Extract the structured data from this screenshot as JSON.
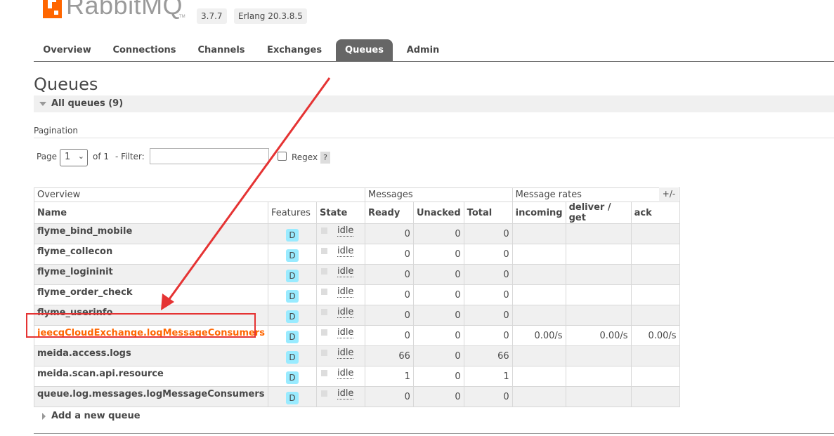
{
  "header": {
    "logo_text": "RabbitMQ",
    "logo_tm": "TM",
    "rabbitmq_version": "3.7.7",
    "erlang_version": "Erlang 20.3.8.5"
  },
  "tabs": [
    {
      "label": "Overview"
    },
    {
      "label": "Connections"
    },
    {
      "label": "Channels"
    },
    {
      "label": "Exchanges"
    },
    {
      "label": "Queues",
      "active": true
    },
    {
      "label": "Admin"
    }
  ],
  "page": {
    "title": "Queues",
    "section_label": "All queues (9)"
  },
  "pagination": {
    "label": "Pagination",
    "page_label": "Page",
    "page_value": "1",
    "of_label": "of 1",
    "filter_label": "- Filter:",
    "filter_value": "",
    "regex_label": "Regex",
    "help_label": "?"
  },
  "table": {
    "group_headers": {
      "overview": "Overview",
      "messages": "Messages",
      "rates": "Message rates"
    },
    "columns": {
      "name": "Name",
      "features": "Features",
      "state": "State",
      "ready": "Ready",
      "unacked": "Unacked",
      "total": "Total",
      "incoming": "incoming",
      "deliver_get": "deliver / get",
      "ack": "ack"
    },
    "column_toggle": "+/-",
    "rows": [
      {
        "name": "flyme_bind_mobile",
        "feature": "D",
        "state": "idle",
        "ready": "0",
        "unacked": "0",
        "total": "0",
        "incoming": "",
        "deliver_get": "",
        "ack": ""
      },
      {
        "name": "flyme_collecon",
        "feature": "D",
        "state": "idle",
        "ready": "0",
        "unacked": "0",
        "total": "0",
        "incoming": "",
        "deliver_get": "",
        "ack": ""
      },
      {
        "name": "flyme_logininit",
        "feature": "D",
        "state": "idle",
        "ready": "0",
        "unacked": "0",
        "total": "0",
        "incoming": "",
        "deliver_get": "",
        "ack": ""
      },
      {
        "name": "flyme_order_check",
        "feature": "D",
        "state": "idle",
        "ready": "0",
        "unacked": "0",
        "total": "0",
        "incoming": "",
        "deliver_get": "",
        "ack": ""
      },
      {
        "name": "flyme_userinfo",
        "feature": "D",
        "state": "idle",
        "ready": "0",
        "unacked": "0",
        "total": "0",
        "incoming": "",
        "deliver_get": "",
        "ack": ""
      },
      {
        "name": "jeecgCloudExchange.logMessageConsumers",
        "feature": "D",
        "state": "idle",
        "ready": "0",
        "unacked": "0",
        "total": "0",
        "incoming": "0.00/s",
        "deliver_get": "0.00/s",
        "ack": "0.00/s",
        "highlighted": true
      },
      {
        "name": "meida.access.logs",
        "feature": "D",
        "state": "idle",
        "ready": "66",
        "unacked": "0",
        "total": "66",
        "incoming": "",
        "deliver_get": "",
        "ack": ""
      },
      {
        "name": "meida.scan.api.resource",
        "feature": "D",
        "state": "idle",
        "ready": "1",
        "unacked": "0",
        "total": "1",
        "incoming": "",
        "deliver_get": "",
        "ack": ""
      },
      {
        "name": "queue.log.messages.logMessageConsumers",
        "feature": "D",
        "state": "idle",
        "ready": "0",
        "unacked": "0",
        "total": "0",
        "incoming": "",
        "deliver_get": "",
        "ack": ""
      }
    ]
  },
  "add_queue_label": "Add a new queue",
  "colors": {
    "brand_orange": "#ff6600",
    "feature_badge": "#99ebff",
    "annotation_red": "#e53333",
    "active_tab": "#666666"
  },
  "icons": [
    "rabbitmq-logo-icon",
    "collapse-triangle-icon",
    "expand-triangle-icon",
    "chevron-down-icon"
  ]
}
